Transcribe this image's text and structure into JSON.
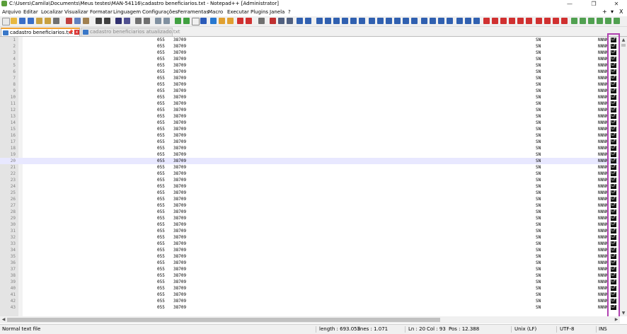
{
  "window": {
    "title": "C:\\Users\\Camila\\Documents\\Meus testes\\MAN-54116\\cadastro beneficiarios.txt - Notepad++ [Administrator]",
    "minimize": "—",
    "maximize": "❐",
    "close": "✕"
  },
  "menu": {
    "items": [
      "Arquivo",
      "Editar",
      "Localizar",
      "Visualizar",
      "Formatar",
      "Linguagem",
      "Configurações",
      "Ferramentas",
      "Macro",
      "Executar",
      "Plugins",
      "Janela",
      "?"
    ],
    "plus": "+",
    "dropdown": "▾",
    "close": "X"
  },
  "tabs": [
    {
      "label": "cadastro beneficiarios.txt",
      "pin": "📌",
      "close": "x"
    },
    {
      "label": "cadastro beneficiarios atualizado.txt"
    }
  ],
  "editor": {
    "current_line": 20,
    "col1": "055",
    "col2": "38709",
    "col3": "SN",
    "col4": "NNNN",
    "eol": "LF",
    "line_numbers": [
      "1",
      "2",
      "3",
      "4",
      "5",
      "6",
      "7",
      "8",
      "9",
      "10",
      "11",
      "12",
      "13",
      "14",
      "15",
      "16",
      "17",
      "18",
      "19",
      "20",
      "21",
      "22",
      "23",
      "24",
      "25",
      "26",
      "27",
      "28",
      "29",
      "30",
      "31",
      "32",
      "33",
      "34",
      "35",
      "36",
      "37",
      "38",
      "39",
      "40",
      "41",
      "42",
      "43"
    ]
  },
  "status": {
    "file_type": "Normal text file",
    "length": "length : 693.053",
    "lines": "lines : 1.071",
    "ln": "Ln : 20",
    "col": "Col : 93",
    "pos": "Pos : 12.388",
    "eol": "Unix (LF)",
    "encoding": "UTF-8",
    "mode": "INS"
  },
  "colors": {
    "current_line_bg": "#e8e8ff",
    "highlight_border": "#b040b0",
    "tab_accent": "#f0a030"
  }
}
